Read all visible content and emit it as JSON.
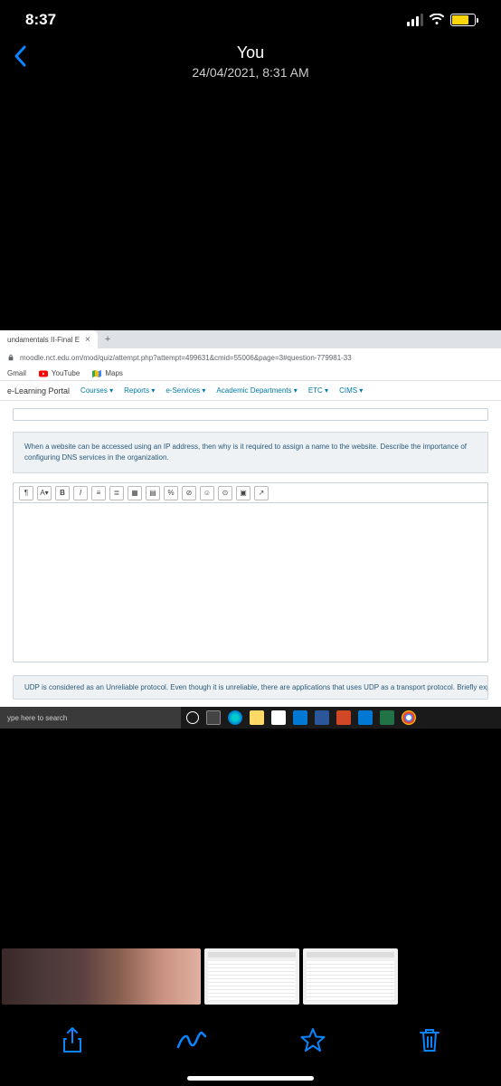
{
  "status": {
    "time": "8:37"
  },
  "header": {
    "title": "You",
    "timestamp": "24/04/2021, 8:31 AM"
  },
  "browser": {
    "tab": "undamentals II-Final E",
    "url": "moodle.nct.edu.om/mod/quiz/attempt.php?attempt=499631&cmid=55006&page=3#question-779981-33",
    "bookmarks": {
      "gmail": "Gmail",
      "youtube": "YouTube",
      "maps": "Maps"
    },
    "nav": {
      "brand": "e-Learning Portal",
      "items": [
        "Courses",
        "Reports",
        "e-Services",
        "Academic Departments",
        "ETC",
        "CIMS"
      ]
    },
    "question1": "When a website can be accessed using an IP address, then why is it required to assign a name to the website. Describe the importance of configuring DNS services in the organization.",
    "toolbar": {
      "para": "¶",
      "font": "A",
      "bold": "B",
      "italic": "I"
    },
    "question2": "UDP is considered as an Unreliable protocol. Even though it is unreliable, there are applications that uses UDP as a transport protocol. Briefly explain why UDP is",
    "search_placeholder": "ype here to search"
  }
}
